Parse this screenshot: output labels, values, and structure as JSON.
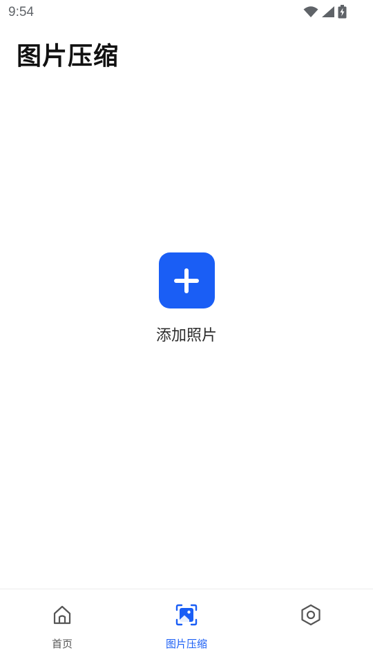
{
  "status_bar": {
    "time": "9:54"
  },
  "header": {
    "title": "图片压缩"
  },
  "main": {
    "add_photo_label": "添加照片"
  },
  "bottom_nav": {
    "items": [
      {
        "label": "首页",
        "icon": "home-icon",
        "active": false
      },
      {
        "label": "图片压缩",
        "icon": "image-compress-icon",
        "active": true
      },
      {
        "label": "",
        "icon": "settings-hexagon-icon",
        "active": false
      }
    ]
  },
  "colors": {
    "accent": "#1a5ef5",
    "inactive": "#555555",
    "title": "#111111"
  }
}
